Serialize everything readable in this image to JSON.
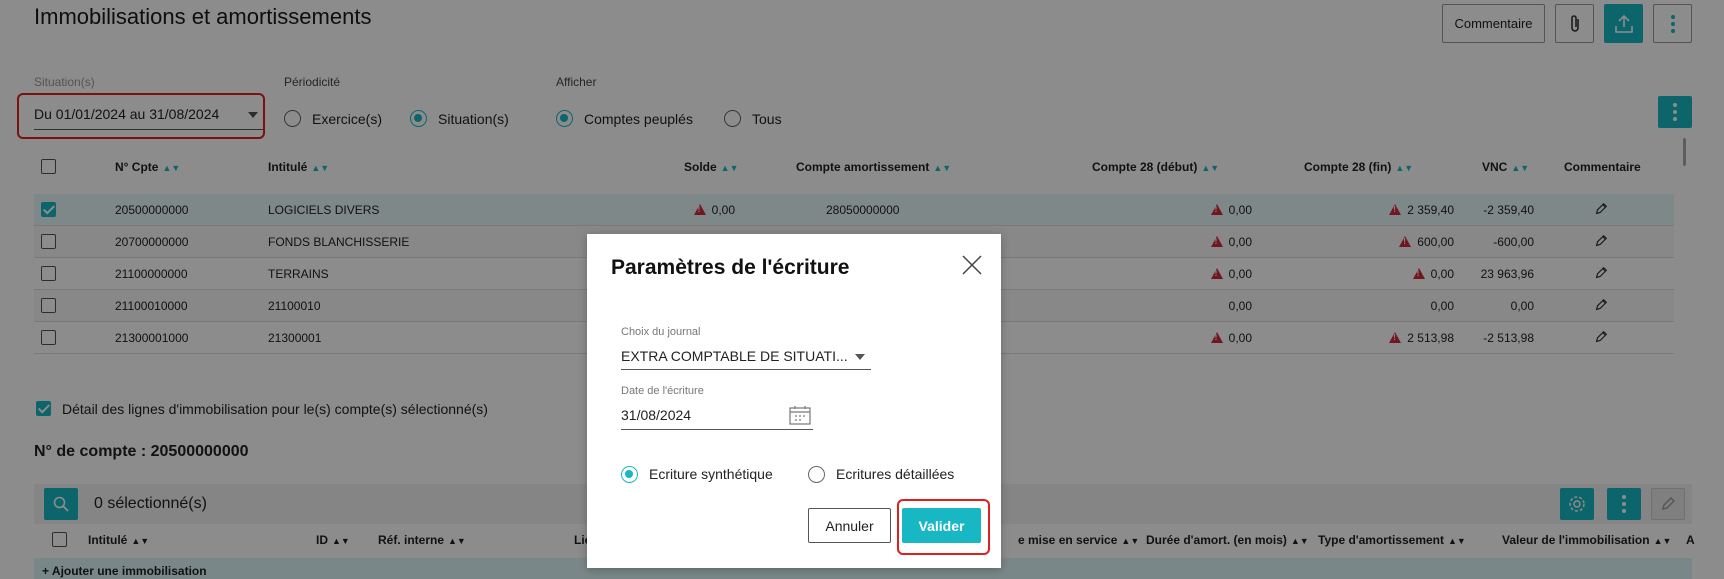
{
  "header": {
    "title": "Immobilisations et amortissements",
    "comment_button": "Commentaire",
    "attach_icon": "paperclip-icon",
    "export_icon": "upload-icon",
    "more_icon": "kebab-icon"
  },
  "filters": {
    "situation_label": "Situation(s)",
    "situation_value": "Du 01/01/2024 au 31/08/2024",
    "periodicity_label": "Périodicité",
    "periodicity_options": [
      "Exercice(s)",
      "Situation(s)"
    ],
    "periodicity_selected": "Situation(s)",
    "show_label": "Afficher",
    "show_options": [
      "Comptes peuplés",
      "Tous"
    ],
    "show_selected": "Comptes peuplés"
  },
  "table": {
    "columns": [
      "N° Cpte",
      "Intitulé",
      "Solde",
      "Compte amortissement",
      "Compte 28 (début)",
      "Compte 28 (fin)",
      "VNC",
      "Commentaire"
    ],
    "rows": [
      {
        "account": "20500000000",
        "label": "LOGICIELS DIVERS",
        "solde": "0,00",
        "solde_warn": true,
        "amort": "28050000000",
        "c28_debut": "0,00",
        "debut_warn": true,
        "c28_fin": "2 359,40",
        "fin_warn": true,
        "vnc": "-2 359,40",
        "checked": true
      },
      {
        "account": "20700000000",
        "label": "FONDS BLANCHISSERIE",
        "solde": "",
        "solde_warn": false,
        "amort": "",
        "c28_debut": "0,00",
        "debut_warn": true,
        "c28_fin": "600,00",
        "fin_warn": true,
        "vnc": "-600,00",
        "checked": false
      },
      {
        "account": "21100000000",
        "label": "TERRAINS",
        "solde": "",
        "solde_warn": false,
        "amort": "",
        "c28_debut": "0,00",
        "debut_warn": true,
        "c28_fin": "0,00",
        "fin_warn": true,
        "vnc": "23 963,96",
        "checked": false
      },
      {
        "account": "21100010000",
        "label": "21100010",
        "solde": "",
        "solde_warn": false,
        "amort": "",
        "c28_debut": "0,00",
        "debut_warn": false,
        "c28_fin": "0,00",
        "fin_warn": false,
        "vnc": "0,00",
        "checked": false
      },
      {
        "account": "21300001000",
        "label": "21300001",
        "solde": "",
        "solde_warn": false,
        "amort": "",
        "c28_debut": "0,00",
        "debut_warn": true,
        "c28_fin": "2 513,98",
        "fin_warn": true,
        "vnc": "-2 513,98",
        "checked": false
      }
    ]
  },
  "detail": {
    "checkbox_label": "Détail des lignes d'immobilisation pour le(s) compte(s) sélectionné(s)",
    "account_title": "N° de compte : 20500000000",
    "selected_count": "0 sélectionné(s)",
    "columns": [
      "Intitulé",
      "ID",
      "Réf. interne",
      "Lie",
      "e mise en service",
      "Durée d'amort. (en mois)",
      "Type d'amortissement",
      "Valeur de l'immobilisation",
      "A"
    ],
    "add_link": "+ Ajouter une immobilisation"
  },
  "modal": {
    "title": "Paramètres de l'écriture",
    "journal_label": "Choix du journal",
    "journal_value": "EXTRA COMPTABLE DE SITUATI...",
    "date_label": "Date de l'écriture",
    "date_value": "31/08/2024",
    "options": [
      "Ecriture synthétique",
      "Ecritures détaillées"
    ],
    "selected_option": "Ecriture synthétique",
    "cancel": "Annuler",
    "confirm": "Valider"
  },
  "colors": {
    "accent": "#17b8c4",
    "warning": "#d02b3a",
    "highlight": "#e02020"
  }
}
